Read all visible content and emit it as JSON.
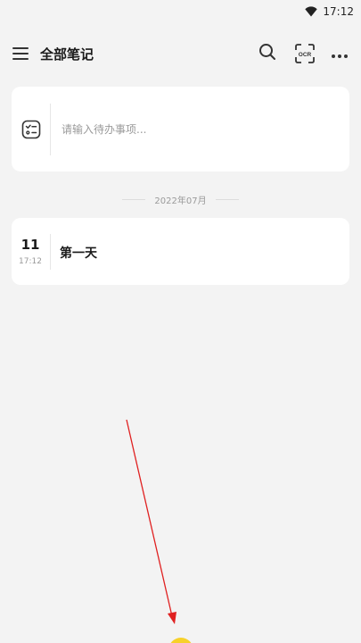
{
  "status_bar": {
    "time": "17:12",
    "icon": "wifi-icon"
  },
  "header": {
    "title": "全部笔记",
    "ocr_label": "OCR",
    "icons": [
      "menu-icon",
      "search-icon",
      "ocr-scan-icon",
      "more-icon"
    ]
  },
  "todo": {
    "placeholder": "请输入待办事项...",
    "icon": "checklist-icon"
  },
  "date_separator": "2022年07月",
  "notes": [
    {
      "day": "11",
      "time": "17:12",
      "title": "第一天"
    }
  ],
  "colors": {
    "background": "#f3f3f3",
    "card": "#ffffff",
    "fab": "#f7d12a",
    "annotation": "#e02020"
  }
}
